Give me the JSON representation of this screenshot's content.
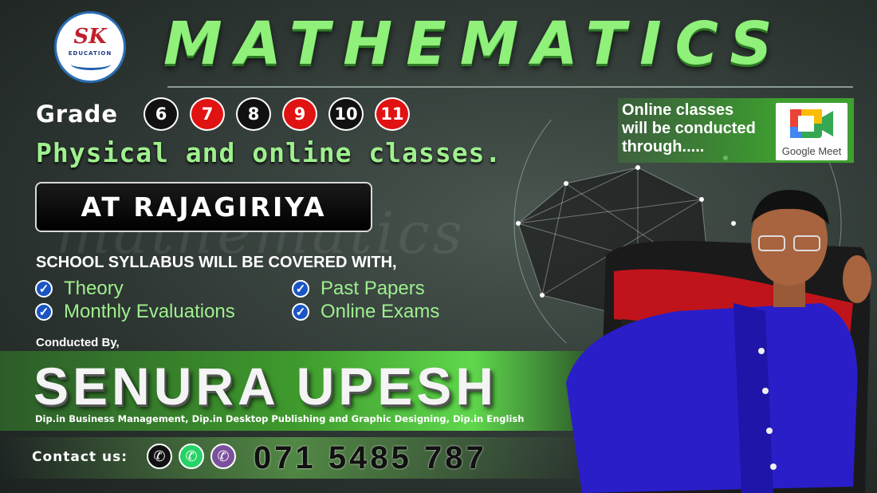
{
  "logo": {
    "text": "SK",
    "sub": "EDUCATION"
  },
  "title": "MATHEMATICS",
  "grade": {
    "label": "Grade",
    "badges": [
      {
        "text": "6",
        "color": "#111111"
      },
      {
        "text": "7",
        "color": "#e11212"
      },
      {
        "text": "8",
        "color": "#111111"
      },
      {
        "text": "9",
        "color": "#e11212"
      },
      {
        "text": "10",
        "color": "#111111"
      },
      {
        "text": "11",
        "color": "#e11212"
      }
    ]
  },
  "tagline": "Physical and online classes.",
  "location": "AT RAJAGIRIYA",
  "syllabus": {
    "heading": "SCHOOL SYLLABUS WILL BE COVERED WITH,",
    "items": [
      "Theory",
      "Monthly Evaluations",
      "Past Papers",
      "Online Exams"
    ]
  },
  "conducted_by": "Conducted By,",
  "teacher": {
    "name": "SENURA UPESH",
    "qualifications": "Dip.in Business Management, Dip.in Desktop Publishing and Graphic Designing, Dip.in English"
  },
  "contact": {
    "label": "Contact us:",
    "phone": "071 5485 787",
    "icons": [
      "phone-icon",
      "whatsapp-icon",
      "viber-icon"
    ]
  },
  "online": {
    "line1": "Online classes",
    "line2": "will be conducted",
    "line3": "through.....",
    "platform": "Google Meet"
  },
  "colors": {
    "accent_green": "#8ff07a",
    "badge_red": "#e11212",
    "badge_black": "#111111"
  }
}
